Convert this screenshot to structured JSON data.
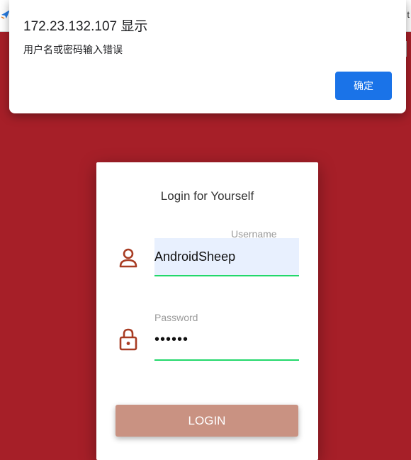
{
  "browser": {
    "right_text": "t"
  },
  "dialog": {
    "title": "172.23.132.107 显示",
    "message": "用户名或密码输入错误",
    "ok_label": "确定"
  },
  "login": {
    "title": "Login for Yourself",
    "username_label": "Username",
    "username_value": "AndroidSheep",
    "password_label": "Password",
    "password_value": "••••••",
    "button_label": "LOGIN",
    "icon_color": "#a83c23",
    "accent_color": "#22d86a"
  }
}
